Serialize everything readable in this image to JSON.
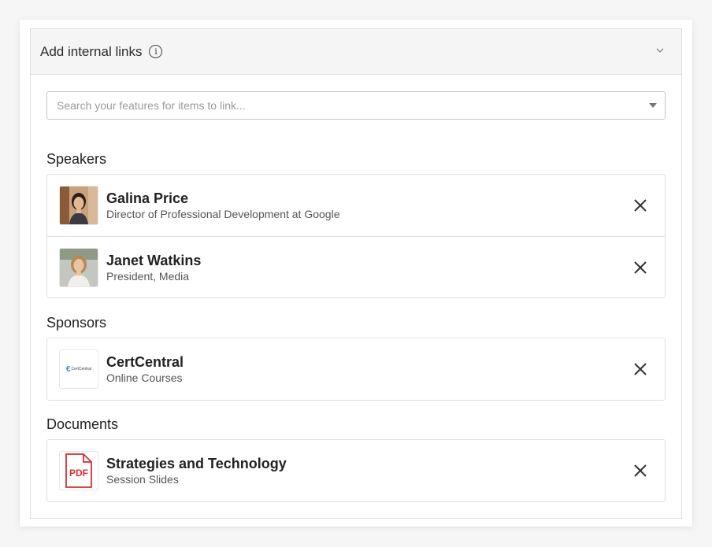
{
  "panel": {
    "title": "Add internal links",
    "info_icon": "info-icon",
    "collapse_icon": "chevron-down-icon"
  },
  "search": {
    "placeholder": "Search your features for items to link...",
    "value": ""
  },
  "sections": {
    "speakers": {
      "title": "Speakers",
      "items": [
        {
          "title": "Galina Price",
          "subtitle": "Director of Professional Development at Google",
          "thumb": "avatar-photo"
        },
        {
          "title": "Janet Watkins",
          "subtitle": "President, Media",
          "thumb": "avatar-photo"
        }
      ]
    },
    "sponsors": {
      "title": "Sponsors",
      "items": [
        {
          "title": "CertCentral",
          "subtitle": "Online Courses",
          "logo_text": "CertCentral",
          "thumb": "sponsor-logo"
        }
      ]
    },
    "documents": {
      "title": "Documents",
      "items": [
        {
          "title": "Strategies and Technology",
          "subtitle": "Session Slides",
          "badge": "PDF",
          "thumb": "pdf-icon"
        }
      ]
    }
  },
  "colors": {
    "pdf_red": "#d32f2f",
    "header_bg": "#f5f5f5",
    "border": "#e0e0e0",
    "logo_blue": "#2a8bd6"
  },
  "remove_icon": "close-icon"
}
